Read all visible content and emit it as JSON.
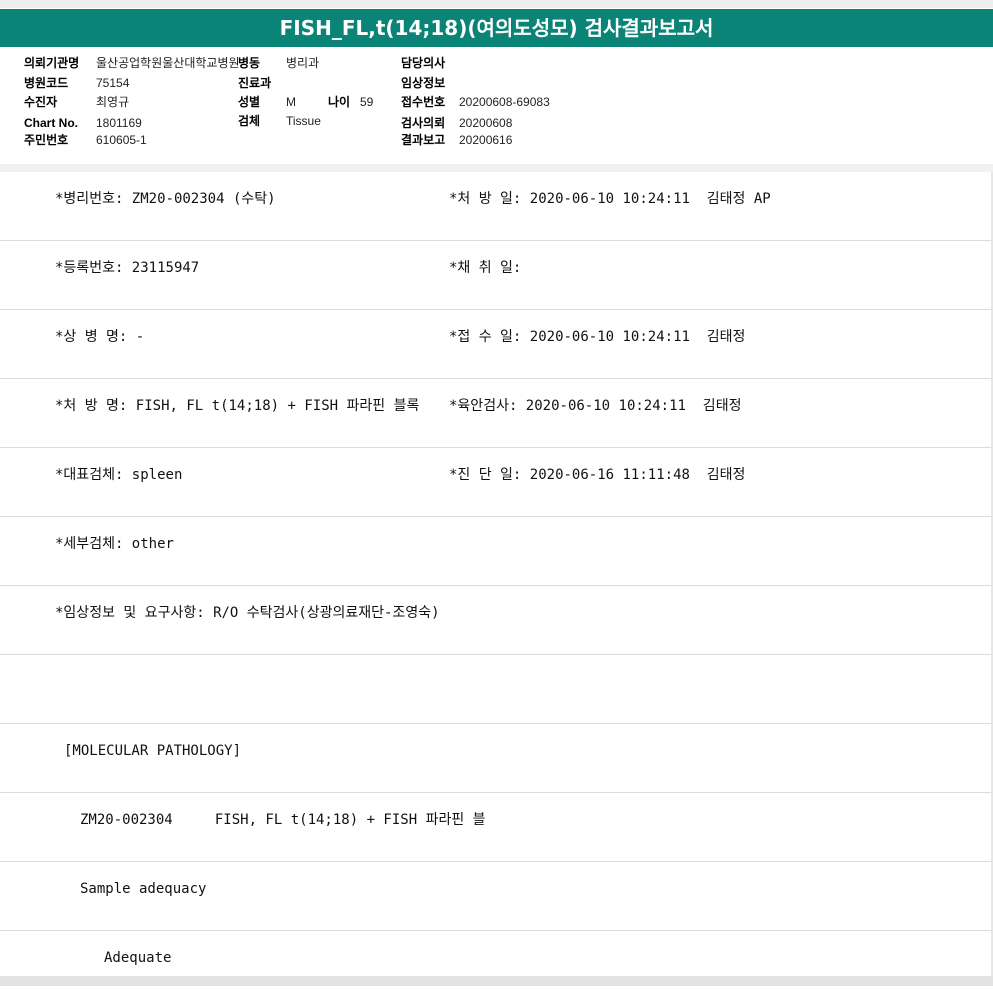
{
  "title": "FISH_FL,t(14;18)(여의도성모) 검사결과보고서",
  "header": {
    "institution_label": "의뢰기관명",
    "institution_value": "울산공업학원울산대학교병원",
    "ward_label": "병동",
    "ward_value": "병리과",
    "doctor_label": "담당의사",
    "doctor_value": "",
    "hospital_code_label": "병원코드",
    "hospital_code_value": "75154",
    "dept_label": "진료과",
    "dept_value": "",
    "clinical_info_label": "임상정보",
    "clinical_info_value": "",
    "patient_label": "수진자",
    "patient_value": "최영규",
    "sex_label": "성별",
    "sex_value": "M",
    "age_label": "나이",
    "age_value": "59",
    "receipt_no_label": "접수번호",
    "receipt_no_value": "20200608-69083",
    "chart_no_label": "Chart No.",
    "chart_no_value": "1801169",
    "specimen_label": "검체",
    "specimen_value": "Tissue",
    "request_label": "검사의뢰",
    "request_value": "20200608",
    "rrn_label": "주민번호",
    "rrn_value": "610605-1",
    "report_label": "결과보고",
    "report_value": "20200616"
  },
  "rows": [
    {
      "left": "*병리번호: ZM20-002304 (수탁)",
      "right": "*처 방 일: 2020-06-10 10:24:11  김태정 AP"
    },
    {
      "left": "*등록번호: 23115947",
      "right": "*채 취 일:"
    },
    {
      "left": "*상 병 명: -",
      "right": "*접 수 일: 2020-06-10 10:24:11  김태정"
    },
    {
      "left": "*처 방 명: FISH, FL t(14;18) + FISH 파라핀 블록",
      "right": "*육안검사: 2020-06-10 10:24:11  김태정"
    },
    {
      "left": "*대표검체: spleen",
      "right": "*진 단 일: 2020-06-16 11:11:48  김태정"
    },
    {
      "left": "*세부검체: other",
      "right": ""
    },
    {
      "left": "*임상정보 및 요구사항: R/O 수탁검사(상광의료재단-조영숙)",
      "right": ""
    },
    {
      "left": "",
      "right": ""
    },
    {
      "left": "[MOLECULAR PATHOLOGY]",
      "right": ""
    },
    {
      "left": "ZM20-002304     FISH, FL t(14;18) + FISH 파라핀 블",
      "right": ""
    },
    {
      "left": "Sample adequacy",
      "right": ""
    },
    {
      "left": "Adequate",
      "right": ""
    }
  ]
}
